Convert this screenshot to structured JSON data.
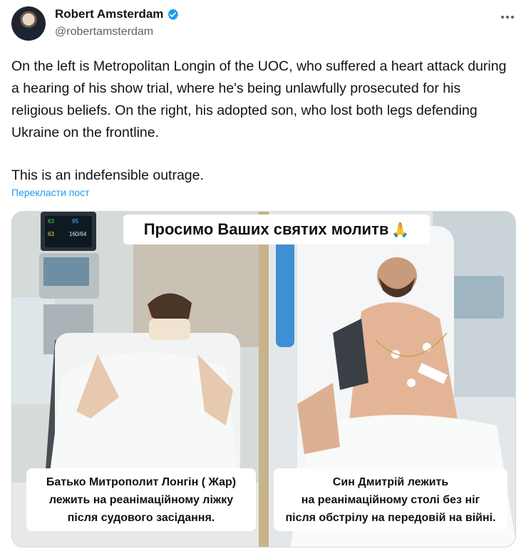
{
  "author": {
    "name": "Robert Amsterdam",
    "handle": "@robertamsterdam"
  },
  "colors": {
    "text": "#0f1419",
    "secondary": "#536471",
    "link": "#1d9bf0",
    "verified": "#1d9bf0",
    "border": "#cfd9de"
  },
  "tweet": {
    "paragraph1": "On the left is Metropolitan Longin of the UOC, who suffered a heart attack during a hearing of his show trial, where he's being unlawfully prosecuted for his religious beliefs. On the right, his adopted son, who lost both legs defending Ukraine on the frontline.",
    "paragraph2": "This is an indefensible outrage.",
    "translate_label": "Перекласти пост"
  },
  "media": {
    "title": "Просимо Ваших святих молитв",
    "title_emoji": "🙏",
    "caption_left": {
      "line1": "Батько Митрополит Лонгін ( Жар)",
      "line2": "лежить на реанімаційному ліжку",
      "line3": "після судового засідання."
    },
    "caption_right": {
      "line1": "Син Дмитрій лежить",
      "line2": "на реанімаційному столі без ніг",
      "line3": "після обстрілу на передовій на війні."
    },
    "monitor_readouts": [
      "63",
      "95",
      "63",
      "160/64"
    ]
  },
  "icons": {
    "verified": "verified-badge-icon",
    "more": "more-options-icon"
  }
}
